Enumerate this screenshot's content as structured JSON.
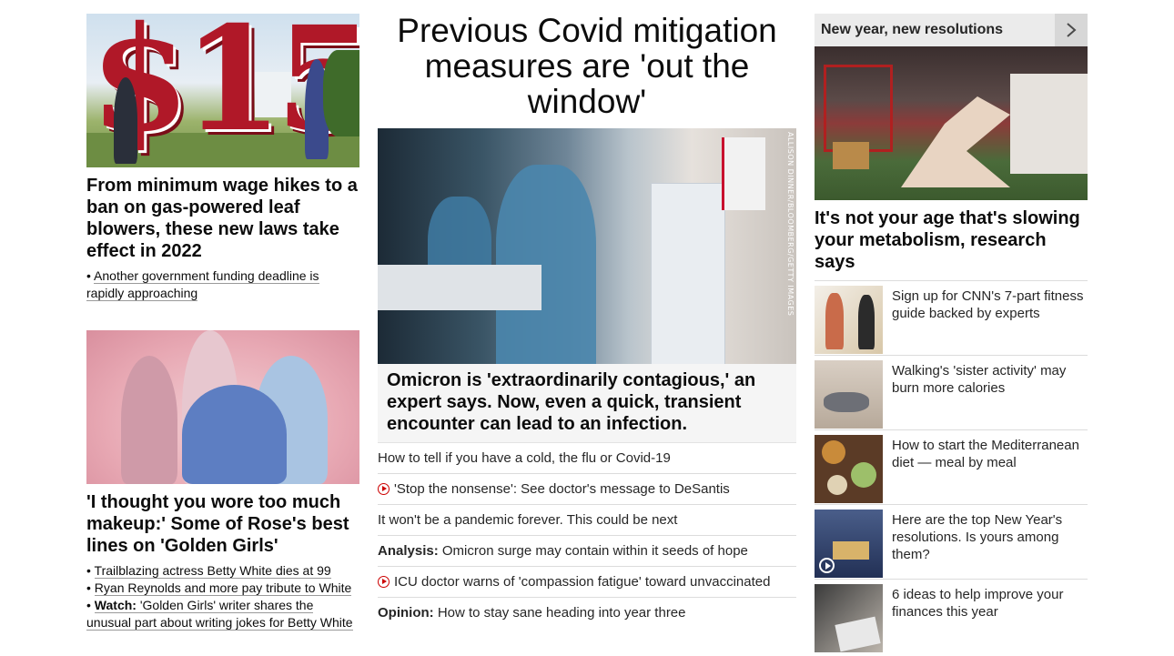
{
  "left": {
    "story1": {
      "image_text": "$15",
      "headline": "From minimum wage hikes to a ban on gas-powered leaf blowers, these new laws take effect in 2022",
      "bullets": [
        "Another government funding deadline is rapidly approaching"
      ]
    },
    "story2": {
      "headline": "'I thought you wore too much makeup:' Some of Rose's best lines on 'Golden Girls'",
      "bullets": [
        {
          "prefix": "",
          "text": "Trailblazing actress Betty White dies at 99"
        },
        {
          "prefix": "",
          "text": "Ryan Reynolds and more pay tribute to White"
        },
        {
          "prefix": "Watch:",
          "text": "'Golden Girls' writer shares the unusual part about writing jokes for Betty White"
        }
      ]
    }
  },
  "center": {
    "title": "Previous Covid mitigation measures are 'out the window'",
    "image_credit": "ALLISON DINNER/BLOOMBERG/GETTY IMAGES",
    "caption": "Omicron is 'extraordinarily contagious,' an expert says. Now, even a quick, transient encounter can lead to an infection.",
    "links": [
      {
        "prefix": "",
        "text": "How to tell if you have a cold, the flu or Covid-19",
        "video": false
      },
      {
        "prefix": "",
        "text": "'Stop the nonsense': See doctor's message to DeSantis",
        "video": true
      },
      {
        "prefix": "",
        "text": "It won't be a pandemic forever. This could be next",
        "video": false
      },
      {
        "prefix": "Analysis:",
        "text": "Omicron surge may contain within it seeds of hope",
        "video": false
      },
      {
        "prefix": "",
        "text": "ICU doctor warns of 'compassion fatigue' toward unvaccinated",
        "video": true
      },
      {
        "prefix": "Opinion:",
        "text": "How to stay sane heading into year three",
        "video": false
      }
    ]
  },
  "right": {
    "section_title": "New year, new resolutions",
    "headline": "It's not your age that's slowing your metabolism, research says",
    "items": [
      {
        "text": "Sign up for CNN's 7-part fitness guide backed by experts",
        "video": false
      },
      {
        "text": "Walking's 'sister activity' may burn more calories",
        "video": false
      },
      {
        "text": "How to start the Mediterranean diet — meal by meal",
        "video": false
      },
      {
        "text": "Here are the top New Year's resolutions. Is yours among them?",
        "video": true
      },
      {
        "text": "6 ideas to help improve your finances this year",
        "video": false
      }
    ]
  },
  "colors": {
    "accent_red": "#cc0000",
    "caption_bg": "#f5f5f5",
    "header_bg": "#ebebeb"
  }
}
